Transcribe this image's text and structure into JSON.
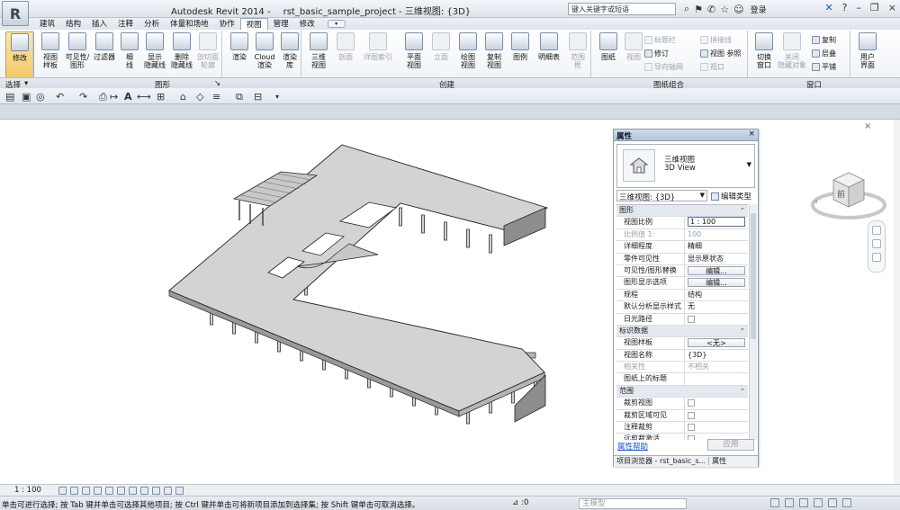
{
  "app": {
    "logo_letter": "R",
    "title_app": "Autodesk Revit 2014 -",
    "title_project": "rst_basic_sample_project - 三维视图: {3D}",
    "search_placeholder": "键入关键字或短语",
    "login_label": "登录"
  },
  "tabs": [
    {
      "label": "建筑",
      "active": false
    },
    {
      "label": "结构",
      "active": false
    },
    {
      "label": "插入",
      "active": false
    },
    {
      "label": "注释",
      "active": false
    },
    {
      "label": "分析",
      "active": false
    },
    {
      "label": "体量和场地",
      "active": false
    },
    {
      "label": "协作",
      "active": false
    },
    {
      "label": "视图",
      "active": true
    },
    {
      "label": "管理",
      "active": false
    },
    {
      "label": "修改",
      "active": false
    }
  ],
  "ribbon": {
    "modify": "修改",
    "view_template": [
      "视图",
      "样板"
    ],
    "visibility": [
      "可见性/",
      "图形"
    ],
    "filters": "过滤器",
    "thin_lines": [
      "细",
      "线"
    ],
    "show_hidden": [
      "显示",
      "隐藏线"
    ],
    "remove_hidden": [
      "删除",
      "隐藏线"
    ],
    "cut_profile": [
      "剖切面",
      "轮廓"
    ],
    "render": "渲染",
    "cloud_render": [
      "Cloud",
      "渲染"
    ],
    "render_gallery": [
      "渲染",
      "库"
    ],
    "view_3d": [
      "三维",
      "视图"
    ],
    "section": "剖面",
    "callout": [
      "详图索引",
      ""
    ],
    "plan_views": [
      "平面",
      "视图"
    ],
    "elevation": "立面",
    "drafting_view": [
      "绘图",
      "视图"
    ],
    "duplicate_view": [
      "复制",
      "视图"
    ],
    "legends": "图例",
    "schedules": "明细表",
    "scope_box": [
      "范围",
      "框"
    ],
    "sheet": "图纸",
    "view": "视图",
    "title_block": "标题栏",
    "revisions": "修订",
    "guide_grid": "导向轴网",
    "matchline": "拼接线",
    "view_reference": "视图 参照",
    "viewports": "视口",
    "switch_windows": [
      "切换",
      "窗口"
    ],
    "close_hidden": [
      "关闭",
      "隐藏对象"
    ],
    "replicate": "复制",
    "cascade": "层叠",
    "tile": "平铺",
    "user_interface": [
      "用户",
      "界面"
    ]
  },
  "panels": {
    "select": "选择",
    "graphics": "图形",
    "create": "创建",
    "sheet_composition": "图纸组合",
    "windows": "窗口"
  },
  "properties": {
    "title": "属性",
    "close": "×",
    "type_name_cn": "三维视图",
    "type_name_en": "3D View",
    "filter_value": "三维视图: {3D}",
    "edit_type": "编辑类型",
    "rows": [
      {
        "section": true,
        "key": "图形"
      },
      {
        "key": "视图比例",
        "value": "1 : 100",
        "kind": "input"
      },
      {
        "key": "比例值 1:",
        "value": "100",
        "dim": true
      },
      {
        "key": "详细程度",
        "value": "精细"
      },
      {
        "key": "零件可见性",
        "value": "显示原状态"
      },
      {
        "key": "可见性/图形替换",
        "value": "编辑...",
        "kind": "button"
      },
      {
        "key": "图形显示选项",
        "value": "编辑...",
        "kind": "button"
      },
      {
        "key": "规程",
        "value": "结构"
      },
      {
        "key": "默认分析显示样式",
        "value": "无"
      },
      {
        "key": "日光路径",
        "value": "",
        "kind": "check"
      },
      {
        "section": true,
        "key": "标识数据"
      },
      {
        "key": "视图样板",
        "value": "<无>",
        "kind": "button"
      },
      {
        "key": "视图名称",
        "value": "{3D}"
      },
      {
        "key": "相关性",
        "value": "不相关",
        "dim": true
      },
      {
        "key": "图纸上的标题",
        "value": ""
      },
      {
        "section": true,
        "key": "范围"
      },
      {
        "key": "裁剪视图",
        "value": "",
        "kind": "check"
      },
      {
        "key": "裁剪区域可见",
        "value": "",
        "kind": "check"
      },
      {
        "key": "注释裁剪",
        "value": "",
        "kind": "check"
      },
      {
        "key": "远剪裁激活",
        "value": "",
        "kind": "check"
      }
    ],
    "help_link": "属性帮助",
    "apply": "应用",
    "bottom_tab1": "项目浏览器 - rst_basic_s...",
    "bottom_tab2": "属性"
  },
  "navcube": {
    "face": "前"
  },
  "viewbar": {
    "scale": "1 : 100"
  },
  "status": {
    "text": "单击可进行选择; 按 Tab 键并单击可选择其他项目; 按 Ctrl 键并单击可将新项目添加到选择集; 按 Shift 键单击可取消选择。",
    "zero": ":0",
    "model_placeholder": "主模型"
  }
}
